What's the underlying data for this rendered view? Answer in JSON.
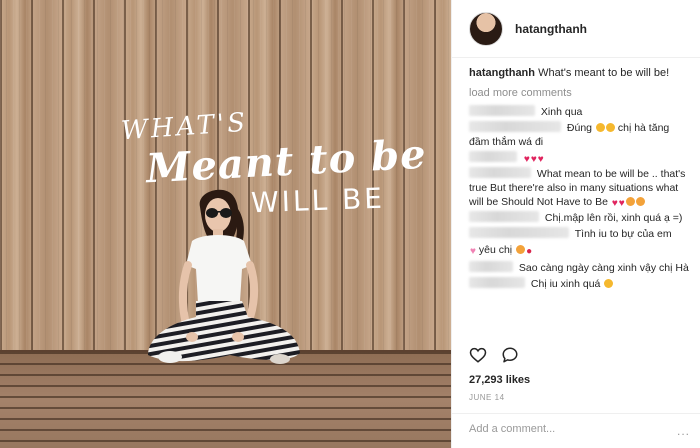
{
  "photo": {
    "hand_lettering": {
      "line1": "WHAT'S",
      "line2": "Meant to be",
      "line3": "WILL BE"
    }
  },
  "post": {
    "username": "hatangthanh",
    "caption": {
      "username": "hatangthanh",
      "text": "What's meant to be will be!"
    },
    "load_more": "load more comments",
    "comments": [
      {
        "text": "Xinh qua",
        "emoji": []
      },
      {
        "text": "Đúng",
        "emoji": [
          "emo-smile",
          "emo-smile"
        ],
        "text_after": "chị hà tăng đầm thắm wá đi"
      },
      {
        "text": "",
        "emoji": [
          "emo-heart",
          "emo-heart",
          "emo-heart"
        ]
      },
      {
        "text": "What mean to be will be .. that's true But there're also in many situations what will be Should Not Have to Be",
        "emoji": [
          "emo-heart",
          "emo-heart",
          "emo-kiss",
          "emo-kiss"
        ]
      },
      {
        "text": "Chị.mập lên rồi, xinh quá ạ =)",
        "emoji": []
      },
      {
        "text": "Tình iu to bự của em",
        "emoji": []
      },
      {
        "text": "yêu chị",
        "emoji": [
          "emo-kiss",
          "emo-lips"
        ]
      },
      {
        "text": "Sao càng ngày càng xinh vậy chị Hà",
        "emoji": []
      },
      {
        "text": "Chị iu xinh quá",
        "emoji": [
          "emo-smile"
        ]
      }
    ],
    "likes": "27,293 likes",
    "date": "JUNE 14",
    "add_comment_placeholder": "Add a comment...",
    "more_label": "..."
  },
  "icons": {
    "like": "heart-outline-icon",
    "comment": "speech-bubble-icon",
    "more": "more-dots-icon"
  },
  "colors": {
    "text": "#262626",
    "muted": "#8e8e8e",
    "heart": "#e0245e",
    "border": "#efefef"
  }
}
